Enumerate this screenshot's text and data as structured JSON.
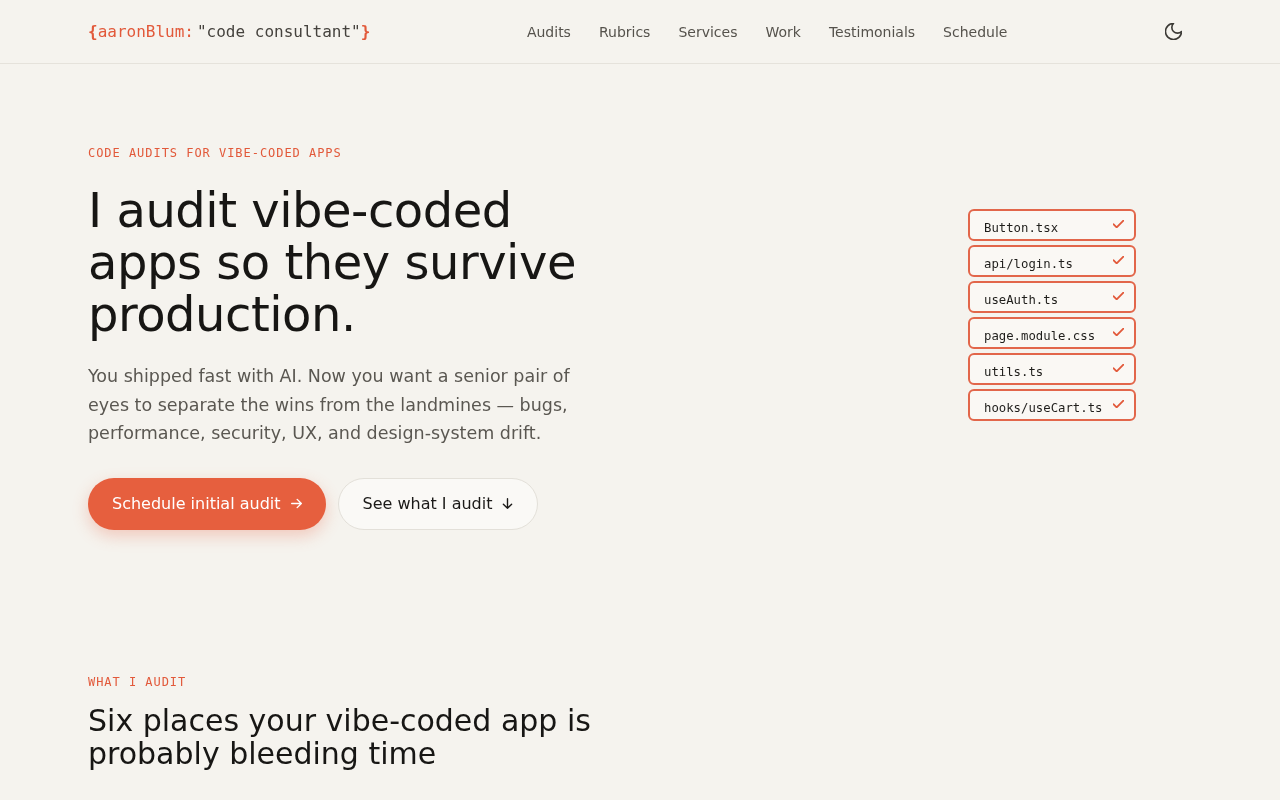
{
  "header": {
    "logo": [
      {
        "text": "{",
        "kind": "punct"
      },
      {
        "text": "aaronBlum:",
        "kind": "key"
      },
      {
        "text": "\"code consultant\"",
        "kind": "value"
      },
      {
        "text": "}",
        "kind": "punct"
      }
    ],
    "nav": [
      {
        "label": "Audits"
      },
      {
        "label": "Rubrics"
      },
      {
        "label": "Services"
      },
      {
        "label": "Work"
      },
      {
        "label": "Testimonials"
      },
      {
        "label": "Schedule"
      }
    ]
  },
  "hero": {
    "eyebrow": "CODE AUDITS FOR VIBE-CODED APPS",
    "title": "I audit vibe-coded apps so they survive production.",
    "lead": "You shipped fast with AI. Now you want a senior pair of eyes to separate the wins from the landmines — bugs, performance, security, UX, and design-system drift.",
    "actions": [
      {
        "label": "Schedule initial audit",
        "kind": "primary"
      },
      {
        "label": "See what I audit",
        "kind": "secondary"
      }
    ],
    "files": [
      {
        "name": "Button.tsx",
        "checked": true
      },
      {
        "name": "api/login.ts",
        "checked": true
      },
      {
        "name": "useAuth.ts",
        "checked": true
      },
      {
        "name": "page.module.css",
        "checked": true
      },
      {
        "name": "utils.ts",
        "checked": true
      },
      {
        "name": "hooks/useCart.ts",
        "checked": true
      }
    ]
  },
  "section": {
    "eyebrow": "WHAT I AUDIT",
    "title": "Six places your vibe-coded app is probably bleeding time"
  }
}
